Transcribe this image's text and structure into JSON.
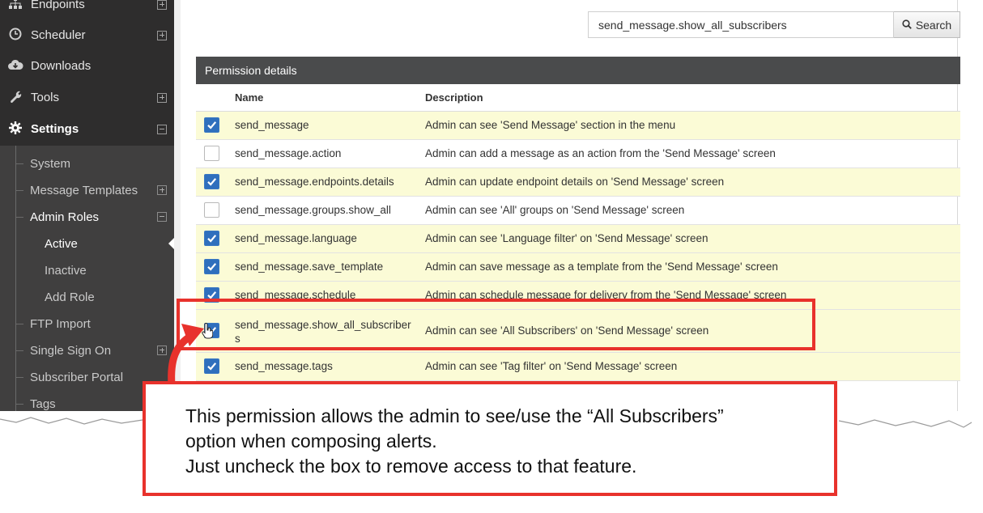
{
  "sidebar": {
    "top_items": [
      {
        "label": "Endpoints",
        "icon": "sitemap-icon",
        "expander": "plus"
      },
      {
        "label": "Scheduler",
        "icon": "clock-icon",
        "expander": "plus"
      },
      {
        "label": "Downloads",
        "icon": "cloud-download-icon",
        "expander": ""
      },
      {
        "label": "Tools",
        "icon": "wrench-icon",
        "expander": "plus"
      },
      {
        "label": "Settings",
        "icon": "gear-icon",
        "expander": "minus"
      }
    ],
    "settings_items": [
      {
        "label": "System",
        "expander": ""
      },
      {
        "label": "Message Templates",
        "expander": "plus"
      },
      {
        "label": "Admin Roles",
        "expander": "minus"
      },
      {
        "label": "Active",
        "expander": ""
      },
      {
        "label": "Inactive",
        "expander": ""
      },
      {
        "label": "Add Role",
        "expander": ""
      },
      {
        "label": "FTP Import",
        "expander": ""
      },
      {
        "label": "Single Sign On",
        "expander": "plus"
      },
      {
        "label": "Subscriber Portal",
        "expander": ""
      },
      {
        "label": "Tags",
        "expander": ""
      }
    ]
  },
  "search": {
    "value": "send_message.show_all_subscribers",
    "button_label": "Search",
    "button_icon": "search-icon"
  },
  "panel": {
    "title": "Permission details",
    "columns": [
      "Name",
      "Description"
    ],
    "rows": [
      {
        "checked": true,
        "name": "send_message",
        "description": "Admin can see 'Send Message' section in the menu"
      },
      {
        "checked": false,
        "name": "send_message.action",
        "description": "Admin can add a message as an action from the 'Send Message' screen"
      },
      {
        "checked": true,
        "name": "send_message.endpoints.details",
        "description": "Admin can update endpoint details on 'Send Message' screen"
      },
      {
        "checked": false,
        "name": "send_message.groups.show_all",
        "description": "Admin can see 'All' groups on 'Send Message' screen"
      },
      {
        "checked": true,
        "name": "send_message.language",
        "description": "Admin can see 'Language filter' on 'Send Message' screen"
      },
      {
        "checked": true,
        "name": "send_message.save_template",
        "description": "Admin can save message as a template from the 'Send Message' screen"
      },
      {
        "checked": true,
        "name": "send_message.schedule",
        "description": "Admin can schedule message for delivery from the 'Send Message' screen"
      },
      {
        "checked": true,
        "name": "send_message.show_all_subscribers",
        "description": "Admin can see 'All Subscribers' on 'Send Message' screen"
      },
      {
        "checked": true,
        "name": "send_message.tags",
        "description": "Admin can see 'Tag filter' on 'Send Message' screen"
      }
    ]
  },
  "callout": {
    "line1": "This permission allows the admin to see/use the “All Subscribers”",
    "line2": "option when composing alerts.",
    "line3": "Just uncheck the box to remove access to that feature."
  },
  "colors": {
    "sidebar_bg": "#2e2d2d",
    "highlight_row": "#fbfbd6",
    "annotation_red": "#e8322c",
    "checkbox_blue": "#2f6fbd"
  }
}
